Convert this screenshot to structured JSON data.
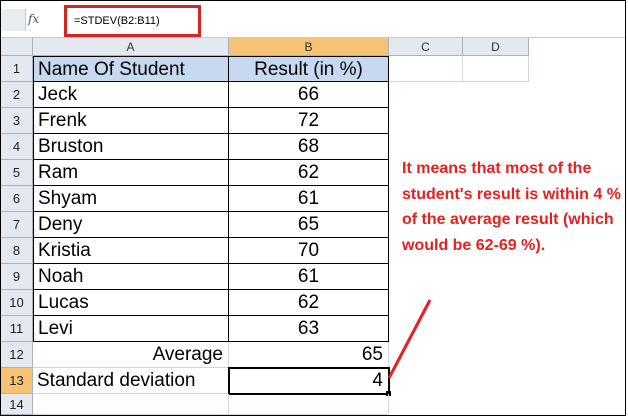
{
  "formula_bar": {
    "fx_icon": "fx",
    "formula": "=STDEV(B2:B11)"
  },
  "columns": [
    "A",
    "B",
    "C",
    "D"
  ],
  "rows": [
    "1",
    "2",
    "3",
    "4",
    "5",
    "6",
    "7",
    "8",
    "9",
    "10",
    "11",
    "12",
    "13",
    "14"
  ],
  "table": {
    "header_name": "Name Of Student",
    "header_result": "Result (in %)",
    "students": [
      {
        "name": "Jeck",
        "result": "66"
      },
      {
        "name": "Frenk",
        "result": "72"
      },
      {
        "name": "Bruston",
        "result": "68"
      },
      {
        "name": "Ram",
        "result": "62"
      },
      {
        "name": "Shyam",
        "result": "61"
      },
      {
        "name": "Deny",
        "result": "65"
      },
      {
        "name": "Kristia",
        "result": "70"
      },
      {
        "name": "Noah",
        "result": "61"
      },
      {
        "name": "Lucas",
        "result": "62"
      },
      {
        "name": "Levi",
        "result": "63"
      }
    ],
    "average_label": "Average",
    "average_value": "65",
    "stdev_label": "Standard deviation",
    "stdev_value": "4"
  },
  "annotation": {
    "text": "It means that most of the student's result is within 4 % of the average result (which would be 62-69 %).",
    "color": "#e82020"
  },
  "colors": {
    "selected_header": "#f6c274",
    "header_fill": "#c6d9f1",
    "highlight_box": "#d42424"
  }
}
